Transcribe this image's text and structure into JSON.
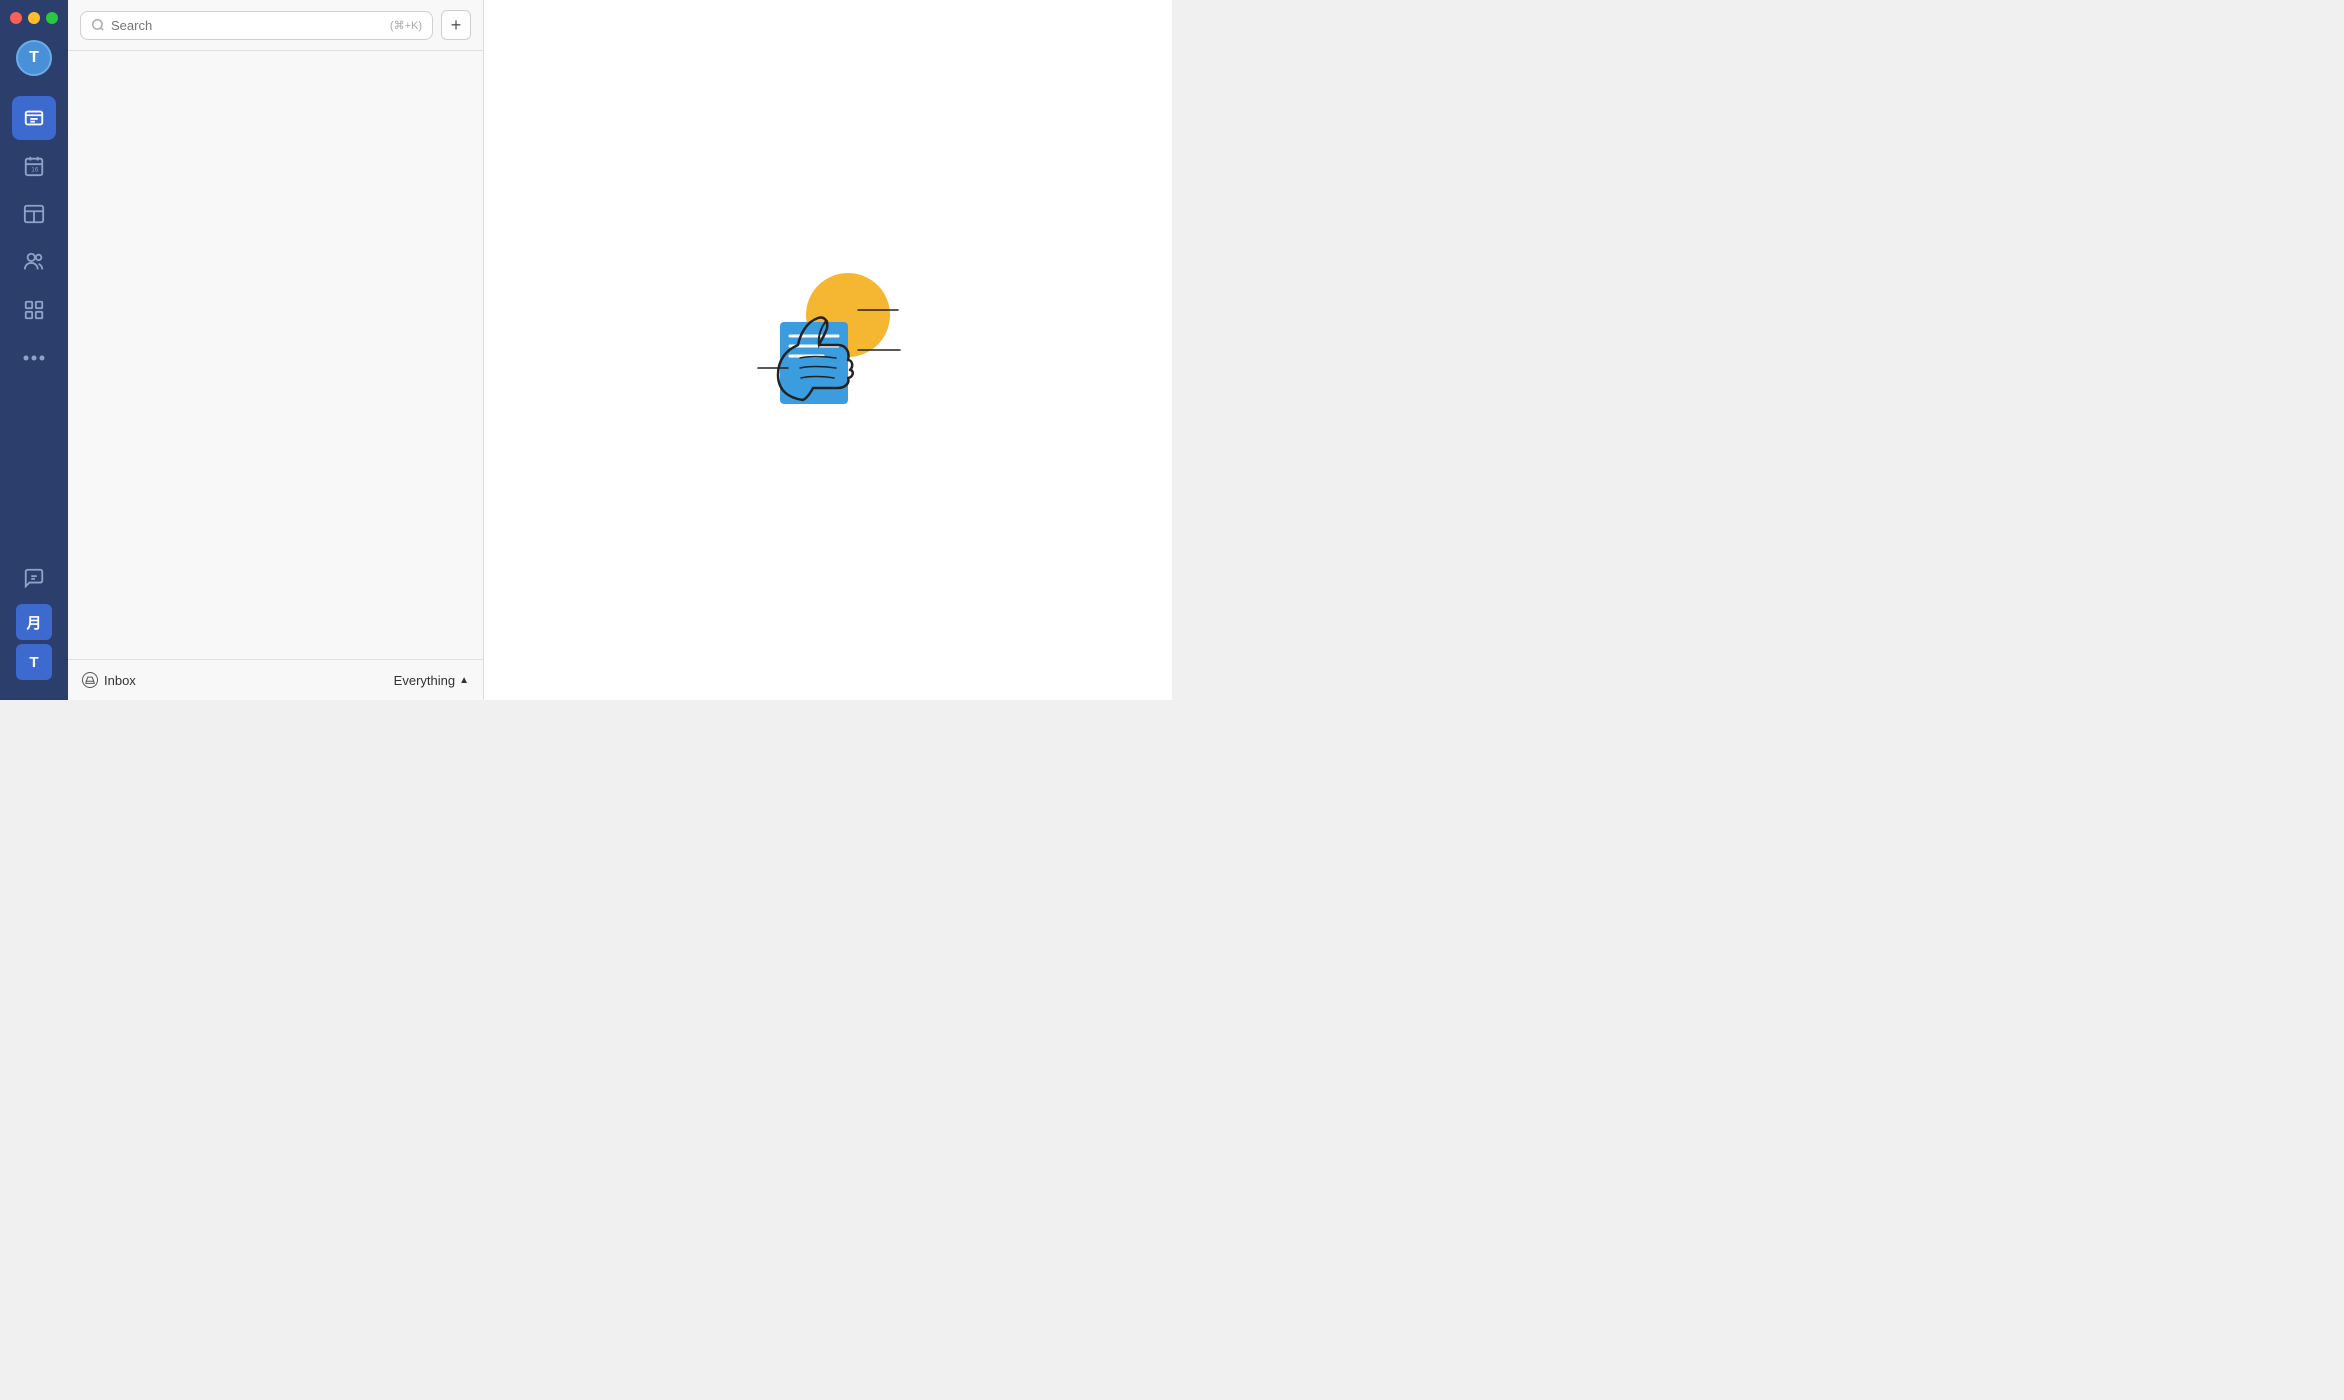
{
  "window_controls": {
    "red": "#ff5f57",
    "yellow": "#ffbd2e",
    "green": "#28c840"
  },
  "avatar": {
    "label": "T"
  },
  "nav": {
    "items": [
      {
        "id": "messages",
        "icon": "≡",
        "active": true
      },
      {
        "id": "calendar",
        "icon": "📅",
        "active": false
      },
      {
        "id": "board",
        "icon": "⊟",
        "active": false
      },
      {
        "id": "contacts",
        "icon": "👤",
        "active": false
      },
      {
        "id": "grid",
        "icon": "⊞",
        "active": false
      },
      {
        "id": "more",
        "icon": "···",
        "active": false
      }
    ],
    "bottom_items": [
      {
        "id": "chat",
        "icon": "💬"
      },
      {
        "id": "profile",
        "label": "月"
      },
      {
        "id": "user",
        "label": "T"
      }
    ]
  },
  "search": {
    "placeholder": "Search",
    "shortcut": "(⌘+K)"
  },
  "add_button": {
    "label": "+"
  },
  "bottom_bar": {
    "inbox_label": "Inbox",
    "everything_label": "Everything",
    "chevron": "▲"
  }
}
